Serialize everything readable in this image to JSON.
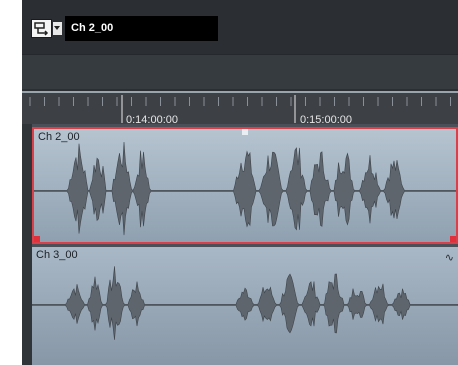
{
  "toolbar": {
    "track_icon": "track-routing-icon",
    "dropdown_icon": "chevron-down-icon",
    "track_name": "Ch 2_00"
  },
  "ruler": {
    "ticks": [
      "0:14:00:00",
      "0:15:00:00"
    ]
  },
  "clips": [
    {
      "name": "Ch 2_00",
      "selected": true
    },
    {
      "name": "Ch 3_00",
      "selected": false,
      "envelope_icon": "envelope-icon"
    }
  ],
  "colors": {
    "selection_border": "#d9404a",
    "clip_fill": "#a9b8c6",
    "waveform": "#5f656d"
  }
}
